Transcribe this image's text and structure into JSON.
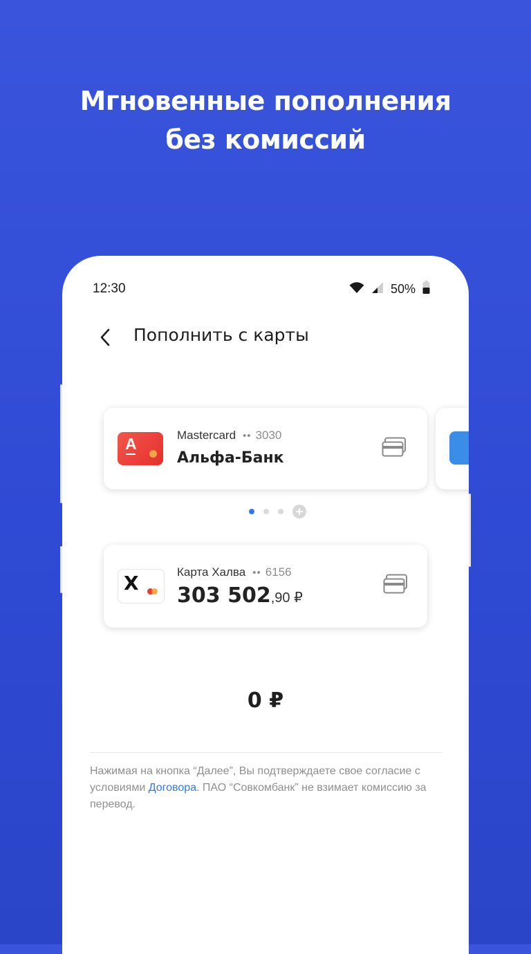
{
  "promo": {
    "headline_line1": "Мгновенные пополнения",
    "headline_line2": "без комиссий"
  },
  "status_bar": {
    "time": "12:30",
    "battery": "50%",
    "icons": [
      "wifi-icon",
      "signal-icon",
      "battery-icon"
    ]
  },
  "header": {
    "back_icon": "chevron-left-icon",
    "title": "Пополнить с карты"
  },
  "source_card": {
    "network": "Mastercard",
    "mask": "••",
    "last4": "3030",
    "bank": "Альфа-Банк",
    "logo_letter": "А",
    "icon": "cards-icon"
  },
  "pager": {
    "count": 3,
    "active_index": 0,
    "add_symbol": "+"
  },
  "target_card": {
    "name": "Карта Халва",
    "mask": "••",
    "last4": "6156",
    "balance_int": "303 502",
    "balance_frac": ",90 ₽",
    "logo_letter": "Х",
    "icon": "cards-icon"
  },
  "amount": "0 ₽",
  "disclaimer": {
    "before": "Нажимая на кнопка “Далее”, Вы подтверждаете свое согласие с условиями ",
    "link": "Договора",
    "after": ". ПАО “Совкомбанк” не взимает комиссию за перевод."
  },
  "colors": {
    "background": "#3350d8",
    "accent": "#2f7ae6",
    "alfa_red": "#ef3e33"
  }
}
